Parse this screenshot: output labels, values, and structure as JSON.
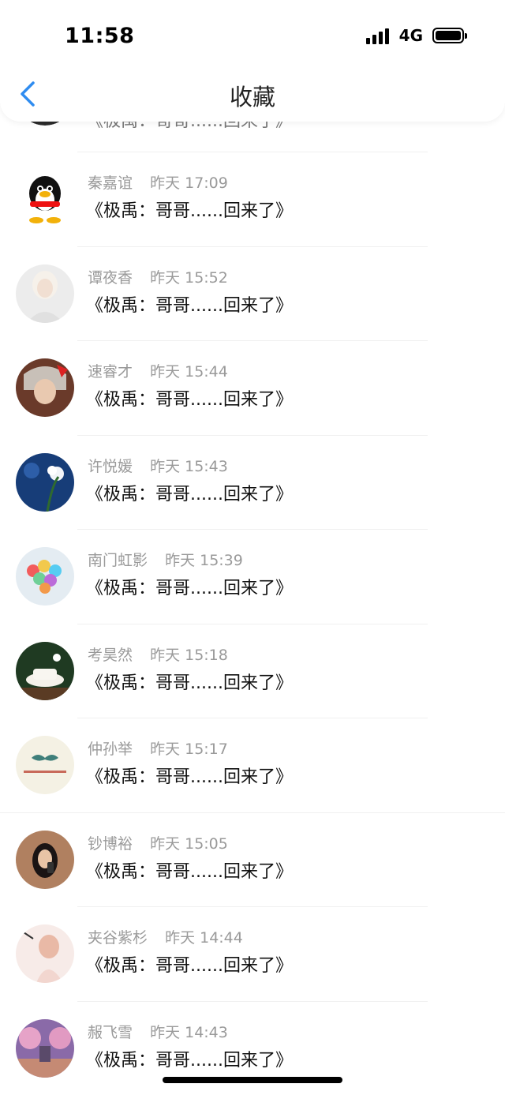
{
  "status_bar": {
    "time": "11:58",
    "network": "4G"
  },
  "header": {
    "title": "收藏"
  },
  "first_row": {
    "content": "《极禹：哥哥......回来了》"
  },
  "items": [
    {
      "name": "秦嘉谊",
      "time": "昨天 17:09",
      "content": "《极禹：哥哥......回来了》"
    },
    {
      "name": "谭夜香",
      "time": "昨天 15:52",
      "content": "《极禹：哥哥......回来了》"
    },
    {
      "name": "速睿才",
      "time": "昨天 15:44",
      "content": "《极禹：哥哥......回来了》"
    },
    {
      "name": "许悦媛",
      "time": "昨天 15:43",
      "content": "《极禹：哥哥......回来了》"
    },
    {
      "name": "南门虹影",
      "time": "昨天 15:39",
      "content": "《极禹：哥哥......回来了》"
    },
    {
      "name": "考昊然",
      "time": "昨天 15:18",
      "content": "《极禹：哥哥......回来了》"
    },
    {
      "name": "仲孙举",
      "time": "昨天 15:17",
      "content": "《极禹：哥哥......回来了》"
    },
    {
      "name": "钞博裕",
      "time": "昨天 15:05",
      "content": "《极禹：哥哥......回来了》"
    },
    {
      "name": "夹谷紫杉",
      "time": "昨天 14:44",
      "content": "《极禹：哥哥......回来了》"
    },
    {
      "name": "赧飞雪",
      "time": "昨天 14:43",
      "content": "《极禹：哥哥......回来了》"
    }
  ],
  "colors": {
    "accent": "#2f8cf0",
    "meta": "#9a9a9a",
    "text": "#111111"
  }
}
